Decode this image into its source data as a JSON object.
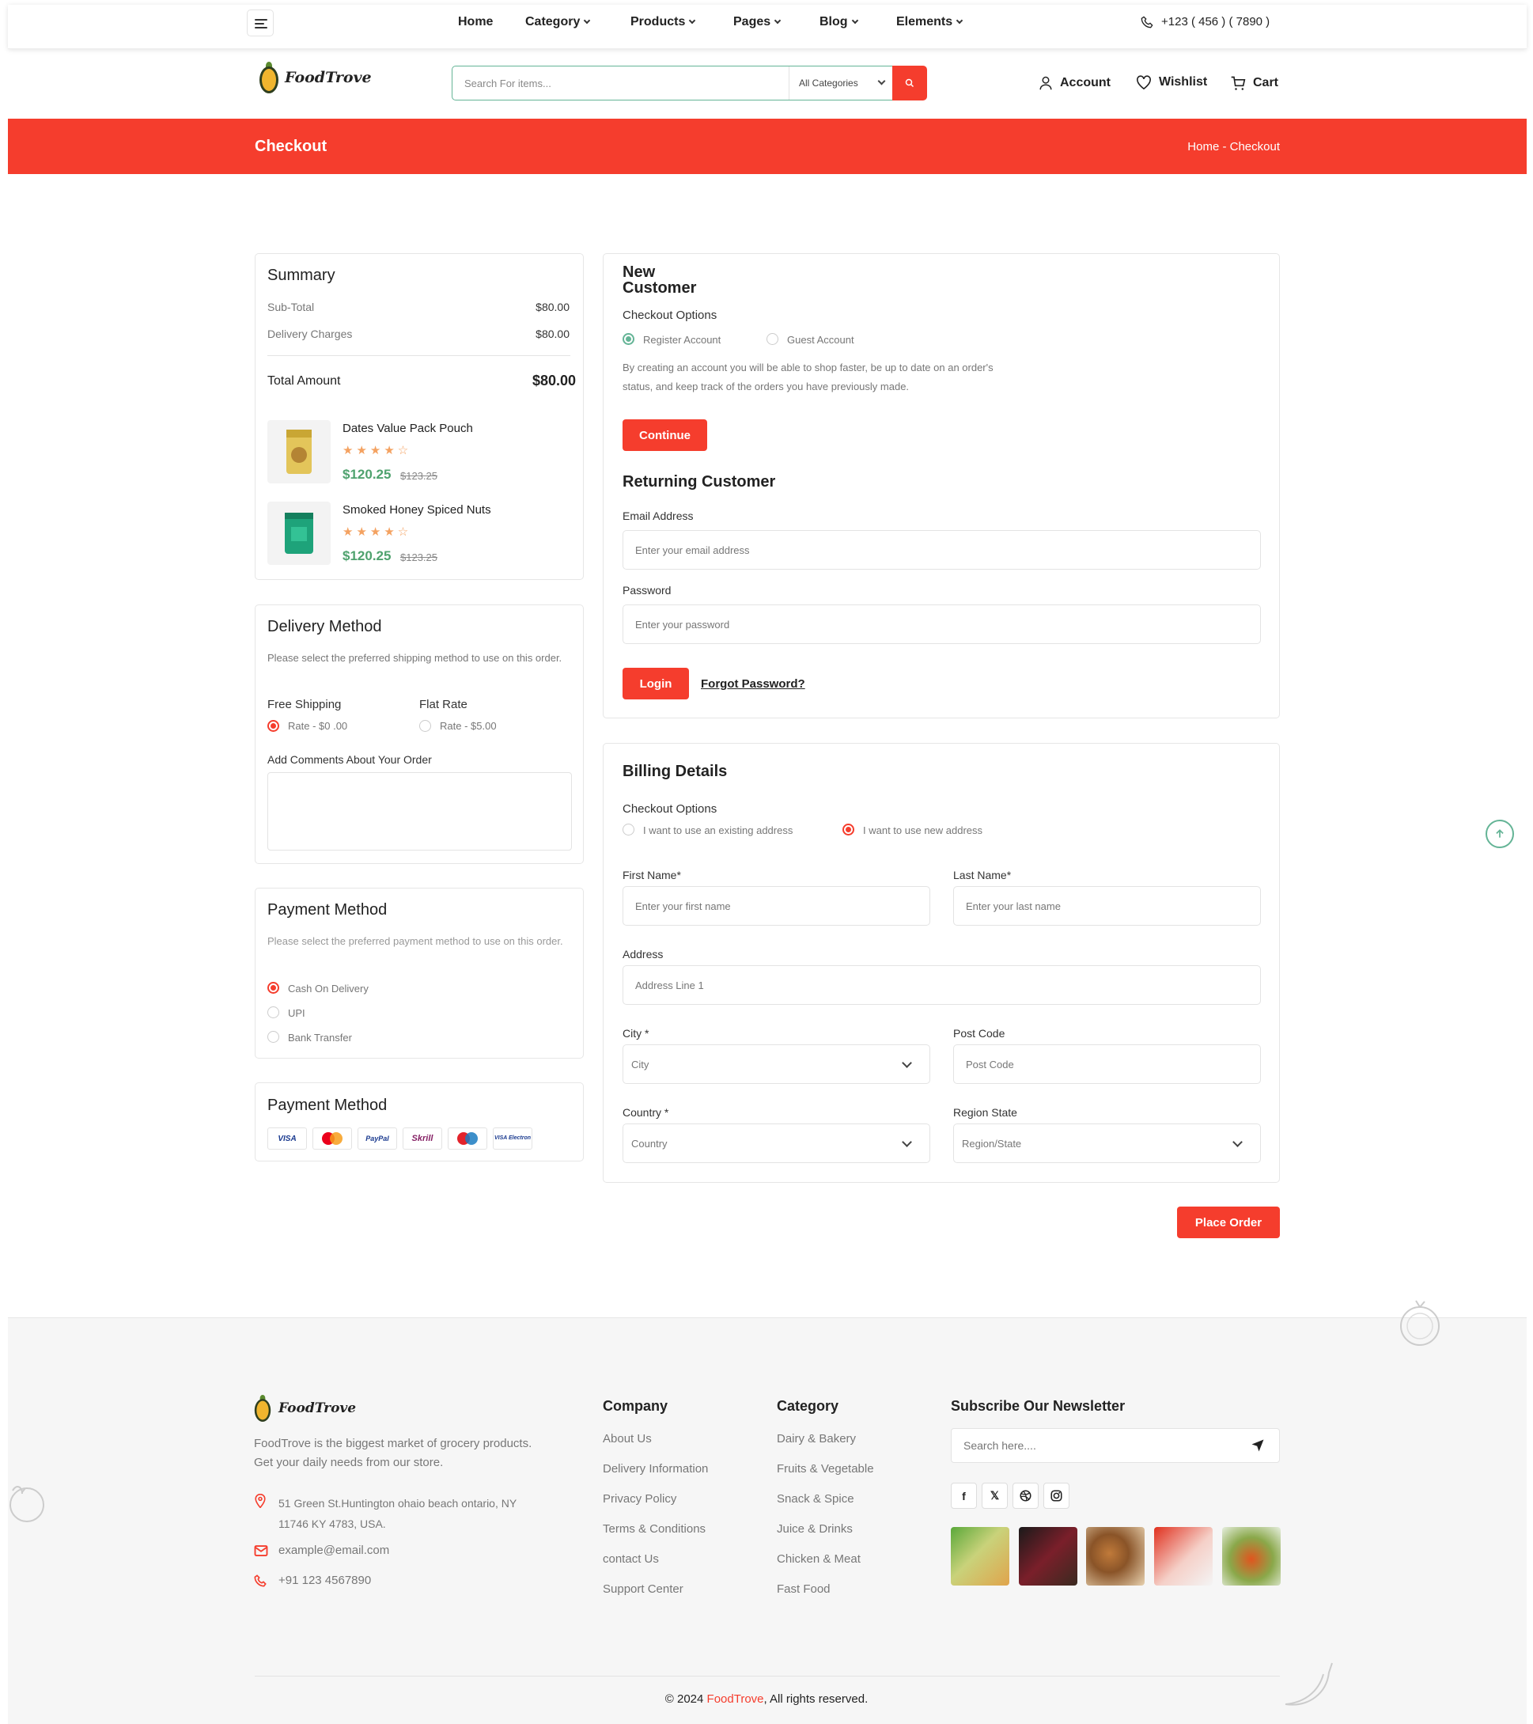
{
  "nav": {
    "items": [
      "Home",
      "Category",
      "Products",
      "Pages",
      "Blog",
      "Elements"
    ],
    "phone": "+123 ( 456 ) ( 7890 )"
  },
  "brand": {
    "name": "FoodTrove"
  },
  "search": {
    "placeholder": "Search For items...",
    "category": "All Categories"
  },
  "header": {
    "account": "Account",
    "wishlist": "Wishlist",
    "cart": "Cart"
  },
  "banner": {
    "title": "Checkout",
    "breadcrumb": "Home - Checkout"
  },
  "summary": {
    "title": "Summary",
    "subtotal_label": "Sub-Total",
    "subtotal": "$80.00",
    "delivery_label": "Delivery Charges",
    "delivery": "$80.00",
    "total_label": "Total Amount",
    "total": "$80.00",
    "products": [
      {
        "name": "Dates Value Pack Pouch",
        "stars": "★★★★☆",
        "price": "$120.25",
        "old_price": "$123.25"
      },
      {
        "name": "Smoked Honey Spiced Nuts",
        "stars": "★★★★☆",
        "price": "$120.25",
        "old_price": "$123.25"
      }
    ]
  },
  "delivery": {
    "title": "Delivery Method",
    "desc": "Please select the preferred shipping method to use on this order.",
    "options": [
      {
        "title": "Free Shipping",
        "rate": "Rate - $0 .00",
        "selected": true
      },
      {
        "title": "Flat Rate",
        "rate": "Rate - $5.00",
        "selected": false
      }
    ],
    "comments_label": "Add Comments About Your Order"
  },
  "payment": {
    "title": "Payment Method",
    "desc": "Please select the preferred payment method to use on this order.",
    "options": [
      "Cash On Delivery",
      "UPI",
      "Bank Transfer"
    ],
    "selected": "Cash On Delivery"
  },
  "payment_cards": {
    "title": "Payment Method",
    "cards": [
      "VISA",
      "MasterCard",
      "PayPal",
      "Skrill",
      "Maestro",
      "VISA Electron"
    ]
  },
  "new_customer": {
    "title_line1": "New",
    "title_line2": "Customer",
    "options_label": "Checkout Options",
    "register": "Register Account",
    "guest": "Guest Account",
    "desc_line1": "By creating an account you will be able to shop faster, be up to date on an order's",
    "desc_line2": "status, and keep track of the orders you have previously made.",
    "continue": "Continue"
  },
  "returning": {
    "title": "Returning Customer",
    "email_label": "Email Address",
    "email_placeholder": "Enter your email address",
    "password_label": "Password",
    "password_placeholder": "Enter your password",
    "login": "Login",
    "forgot": "Forgot Password?"
  },
  "billing": {
    "title": "Billing Details",
    "options_label": "Checkout Options",
    "existing": "I want to use an existing address",
    "new": "I want to use new address",
    "first_label": "First Name*",
    "first_placeholder": "Enter your first name",
    "last_label": "Last Name*",
    "last_placeholder": "Enter your last name",
    "address_label": "Address",
    "address_placeholder": "Address Line 1",
    "city_label": "City *",
    "city_placeholder": "City",
    "post_label": "Post Code",
    "post_placeholder": "Post Code",
    "country_label": "Country *",
    "country_placeholder": "Country",
    "region_label": "Region State",
    "region_placeholder": "Region/State"
  },
  "place_order": "Place Order",
  "footer": {
    "about_line1": "FoodTrove is the biggest market of grocery products.",
    "about_line2": "Get your daily needs from our store.",
    "address_line1": "51 Green St.Huntington ohaio beach ontario, NY",
    "address_line2": "11746 KY 4783, USA.",
    "email": "example@email.com",
    "phone": "+91 123 4567890",
    "company_title": "Company",
    "company_links": [
      "About Us",
      "Delivery Information",
      "Privacy Policy",
      "Terms & Conditions",
      "contact Us",
      "Support Center"
    ],
    "category_title": "Category",
    "category_links": [
      "Dairy & Bakery",
      "Fruits & Vegetable",
      "Snack & Spice",
      "Juice & Drinks",
      "Chicken & Meat",
      "Fast Food"
    ],
    "newsletter_title": "Subscribe Our Newsletter",
    "newsletter_placeholder": "Search here....",
    "copyright_pre": "© 2024 ",
    "copyright_brand": "FoodTrove",
    "copyright_post": ", All rights reserved."
  },
  "colors": {
    "accent": "#f53d2d",
    "green": "#64b496",
    "price": "#4fa26e",
    "star": "#f4a261"
  }
}
